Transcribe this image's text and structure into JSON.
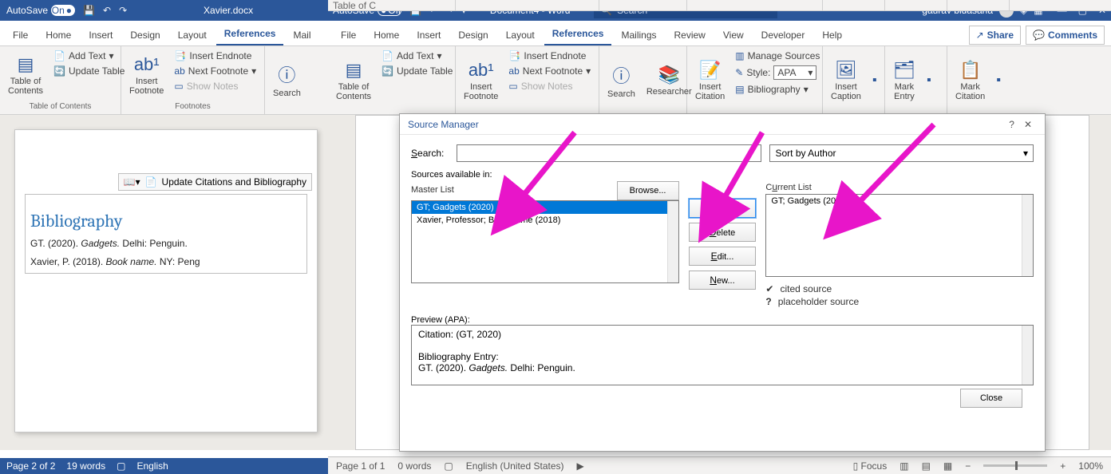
{
  "left": {
    "autosave_label": "AutoSave",
    "autosave_state": "On",
    "doc_title": "Xavier.docx",
    "menu": {
      "file": "File",
      "home": "Home",
      "insert": "Insert",
      "design": "Design",
      "layout": "Layout",
      "references": "References",
      "mail": "Mail"
    },
    "ribbon": {
      "toc": {
        "big": "Table of\nContents",
        "add": "Add Text",
        "upd": "Update Table",
        "group": "Table of Contents"
      },
      "fn": {
        "big": "Insert\nFootnote",
        "end": "Insert Endnote",
        "next": "Next Footnote",
        "show": "Show Notes",
        "group": "Footnotes"
      },
      "search": {
        "big": "Search"
      }
    },
    "update_bar": "Update Citations and Bibliography",
    "biblio_heading": "Bibliography",
    "entry1_a": "GT. (2020). ",
    "entry1_i": "Gadgets.",
    "entry1_b": " Delhi: Penguin.",
    "entry2_a": "Xavier, P. (2018). ",
    "entry2_i": "Book name.",
    "entry2_b": " NY: Peng",
    "status": {
      "page": "Page 2 of 2",
      "words": "19 words",
      "lang": "English"
    }
  },
  "right": {
    "autosave_label": "AutoSave",
    "autosave_state": "Off",
    "doc_title": "Document4 - Word",
    "search_ph": "Search",
    "user": "gaurav bidasaria",
    "menu": {
      "file": "File",
      "home": "Home",
      "insert": "Insert",
      "design": "Design",
      "layout": "Layout",
      "references": "References",
      "mailings": "Mailings",
      "review": "Review",
      "view": "View",
      "developer": "Developer",
      "help": "Help"
    },
    "share": "Share",
    "comments": "Comments",
    "ribbon": {
      "toc": {
        "big": "Table of\nContents",
        "add": "Add Text",
        "upd": "Update Table",
        "group": "Table of C"
      },
      "fn": {
        "big": "Insert\nFootnote",
        "end": "Insert Endnote",
        "next": "Next Footnote",
        "show": "Show Notes"
      },
      "research": {
        "search": "Search",
        "res": "Researcher"
      },
      "cit": {
        "big": "Insert\nCitation",
        "manage": "Manage Sources",
        "style": "Style:",
        "style_val": "APA",
        "bib": "Bibliography"
      },
      "cap": {
        "big": "Insert\nCaption"
      },
      "idx": {
        "big": "Mark\nEntry"
      },
      "auth": {
        "big": "Mark\nCitation"
      }
    },
    "status": {
      "page": "Page 1 of 1",
      "words": "0 words",
      "lang": "English (United States)",
      "focus": "Focus",
      "zoom": "100%"
    }
  },
  "dlg": {
    "title": "Source Manager",
    "search": "Search:",
    "sort": "Sort by Author",
    "avail": "Sources available in:",
    "master": "Master List",
    "current": "Current List",
    "browse": "Browse...",
    "copy": "Copy ->",
    "delete": "Delete",
    "edit": "Edit...",
    "new": "New...",
    "ml_1": "GT; Gadgets (2020)",
    "ml_2": "Xavier, Professor; Book name (2018)",
    "cl_1": "GT; Gadgets (2020)",
    "cited": "cited source",
    "ph": "placeholder source",
    "prev_lbl": "Preview (APA):",
    "prev_l1": "Citation:  (GT, 2020)",
    "prev_l2": "Bibliography Entry:",
    "prev_l3a": "GT. (2020). ",
    "prev_l3i": "Gadgets.",
    "prev_l3b": " Delhi: Penguin.",
    "close": "Close"
  }
}
